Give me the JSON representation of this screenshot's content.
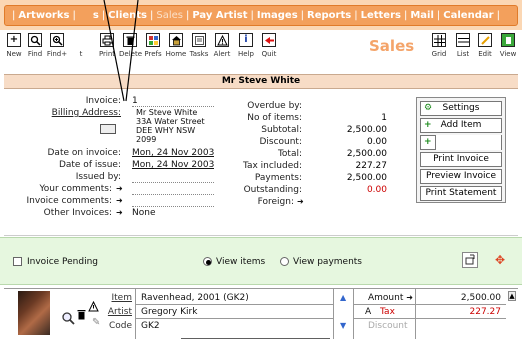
{
  "nav": {
    "items": [
      "Artworks",
      "s",
      "Clients",
      "Sales",
      "Pay Artist",
      "Images",
      "Reports",
      "Letters",
      "Mail",
      "Calendar"
    ],
    "active_index": 3,
    "accent": "#f3a05c"
  },
  "toolbar": {
    "title": "Sales",
    "buttons": [
      {
        "label": "New",
        "icon": "plus-icon"
      },
      {
        "label": "Find",
        "icon": "magnifier-icon"
      },
      {
        "label": "Find+",
        "icon": "magnifier-plus-icon"
      },
      {
        "label": "Print",
        "icon": "printer-icon"
      },
      {
        "label": "Delete",
        "icon": "trash-icon"
      },
      {
        "label": "Prefs",
        "icon": "prefs-icon"
      },
      {
        "label": "Home",
        "icon": "home-icon"
      },
      {
        "label": "Tasks",
        "icon": "tasks-icon"
      },
      {
        "label": "Alert",
        "icon": "alert-icon"
      },
      {
        "label": "Help",
        "icon": "info-icon"
      },
      {
        "label": "Quit",
        "icon": "quit-icon"
      },
      {
        "label": "Grid",
        "icon": "grid-icon"
      },
      {
        "label": "List",
        "icon": "list-icon"
      },
      {
        "label": "Edit",
        "icon": "edit-icon"
      },
      {
        "label": "View",
        "icon": "view-icon"
      }
    ],
    "partial_label": "t"
  },
  "header": {
    "title": "Mr Steve White"
  },
  "invoice": {
    "labels": {
      "invoice": "Invoice:",
      "billing": "Billing Address:",
      "date_on": "Date on invoice:",
      "date_issue": "Date of issue:",
      "issued_by": "Issued by:",
      "your_comments": "Your comments:",
      "invoice_comments": "Invoice comments:",
      "other_invoices": "Other Invoices:"
    },
    "invoice_number": "1",
    "address_lines": [
      "Mr Steve White",
      "33A Water Street",
      "DEE WHY NSW",
      "2099"
    ],
    "date_on_invoice": "Mon, 24 Nov 2003",
    "date_of_issue": "Mon, 24 Nov 2003",
    "other_invoices": "None"
  },
  "totals": {
    "labels": [
      "Overdue by:",
      "No of items:",
      "Subtotal:",
      "Discount:",
      "Total:",
      "Tax included:",
      "Payments:",
      "Outstanding:",
      "Foreign:"
    ],
    "values": [
      "",
      "1",
      "2,500.00",
      "0.00",
      "2,500.00",
      "227.27",
      "2,500.00",
      "0.00",
      ""
    ],
    "outstanding_color": "#cc0000"
  },
  "actions": {
    "settings": "Settings",
    "add_item": "Add Item",
    "print_invoice": "Print Invoice",
    "preview_invoice": "Preview Invoice",
    "print_statement": "Print Statement"
  },
  "band": {
    "pending_label": "Invoice Pending",
    "view_items": "View items",
    "view_payments": "View payments"
  },
  "item": {
    "labels": {
      "item": "Item",
      "artist": "Artist",
      "code": "Code"
    },
    "item_value": "Ravenhead, 2001 (GK2)",
    "artist_value": "Gregory Kirk",
    "code_value": "GK2",
    "amount_label": "Amount",
    "tax_prefix": "A",
    "tax_label": "Tax",
    "discount_label": "Discount",
    "amount_value": "2,500.00",
    "tax_value": "227.27"
  }
}
